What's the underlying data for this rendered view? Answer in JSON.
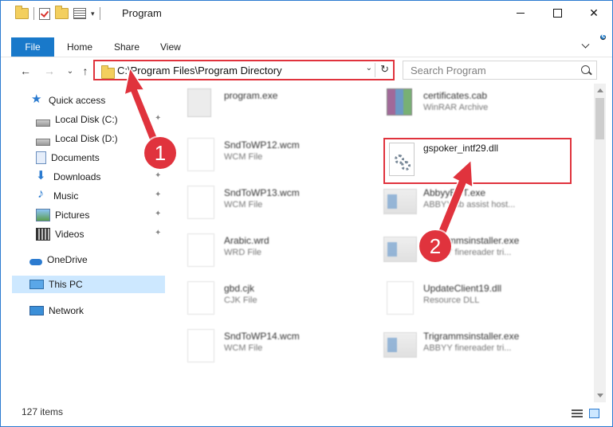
{
  "window": {
    "title": "Program",
    "minimize_label": "–",
    "maximize_label": "",
    "close_label": "✕"
  },
  "ribbon": {
    "tabs": [
      "File",
      "Home",
      "Share",
      "View"
    ],
    "help_label": "?"
  },
  "navigation": {
    "back": "←",
    "forward": "→",
    "recent": "⌄",
    "up": "↑"
  },
  "address": {
    "path": "C:\\Program Files\\Program Directory",
    "refresh": "↻",
    "dropdown": "⌄"
  },
  "search": {
    "placeholder": "Search Program"
  },
  "sidebar": {
    "items": [
      {
        "label": "Quick access",
        "icon": "star-icon"
      },
      {
        "label": "Local Disk (C:)",
        "icon": "disk-icon"
      },
      {
        "label": "Local Disk (D:)",
        "icon": "disk-icon"
      },
      {
        "label": "Documents",
        "icon": "documents-icon"
      },
      {
        "label": "Downloads",
        "icon": "downloads-icon"
      },
      {
        "label": "Music",
        "icon": "music-icon"
      },
      {
        "label": "Pictures",
        "icon": "pictures-icon"
      },
      {
        "label": "Videos",
        "icon": "videos-icon"
      },
      {
        "label": "OneDrive",
        "icon": "cloud-icon"
      },
      {
        "label": "This PC",
        "icon": "computer-icon"
      },
      {
        "label": "Network",
        "icon": "network-icon"
      }
    ],
    "pin_glyph": "📌"
  },
  "files": {
    "left": [
      {
        "name": "program.exe",
        "type": ""
      },
      {
        "name": "SndToWP12.wcm",
        "type": "WCM File"
      },
      {
        "name": "SndToWP13.wcm",
        "type": "WCM File"
      },
      {
        "name": "Arabic.wrd",
        "type": "WRD File"
      },
      {
        "name": "gbd.cjk",
        "type": "CJK File"
      },
      {
        "name": "SndToWP14.wcm",
        "type": "WCM File"
      }
    ],
    "right": [
      {
        "name": "certificates.cab",
        "type": "WinRAR Archive"
      },
      {
        "name": "AbbyyEST.exe",
        "type": "ABBYY sb assist host..."
      },
      {
        "name": "Trigrammsinstaller.exe",
        "type": "ABBYY finereader tri..."
      },
      {
        "name": "UpdateClient19.dll",
        "type": "Resource DLL"
      },
      {
        "name": "Trigrammsinstaller.exe",
        "type": "ABBYY finereader tri..."
      }
    ],
    "highlighted": "gspoker_intf29.dll"
  },
  "annotations": {
    "step1": "1",
    "step2": "2",
    "color": "#e0333d"
  },
  "status": {
    "count": "127 items"
  }
}
